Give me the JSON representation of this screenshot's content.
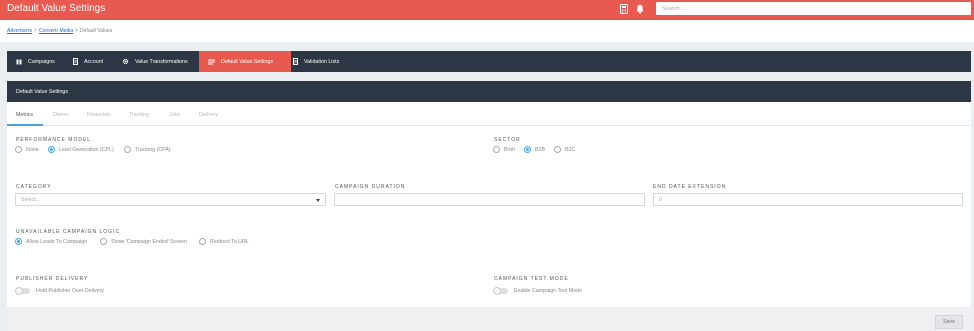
{
  "header": {
    "title": "Default Value Settings",
    "search_placeholder": "Search...",
    "icons": [
      "calculator-icon",
      "bell-icon"
    ]
  },
  "breadcrumb": {
    "items": [
      "Advertisers",
      "Convertr Media",
      "Default Values"
    ],
    "separator": ">"
  },
  "tabs": [
    {
      "label": "Campaigns",
      "icon": "columns-icon",
      "active": false
    },
    {
      "label": "Account",
      "icon": "document-icon",
      "active": false
    },
    {
      "label": "Value Transformations",
      "icon": "gear-icon",
      "active": false
    },
    {
      "label": "Default Value Settings",
      "icon": "list-icon",
      "active": true
    },
    {
      "label": "Validation Lists",
      "icon": "document-icon",
      "active": false
    }
  ],
  "panel": {
    "title": "Default Value Settings",
    "subtabs": [
      "Metrics",
      "Owner",
      "Financials",
      "Tracking",
      "Jobs",
      "Delivery"
    ],
    "active_subtab": "Metrics"
  },
  "performance_model": {
    "label": "Performance Model",
    "options": [
      "None",
      "Lead Generation (CPL)",
      "Tracking (CPA)"
    ],
    "selected": "Lead Generation (CPL)"
  },
  "sector": {
    "label": "Sector",
    "options": [
      "Both",
      "B2B",
      "B2C"
    ],
    "selected": "B2B"
  },
  "category": {
    "label": "Category",
    "placeholder": "Select..."
  },
  "campaign_duration": {
    "label": "Campaign Duration",
    "value": ""
  },
  "end_date_extension": {
    "label": "End Date Extension",
    "value": "0"
  },
  "unavailable_logic": {
    "label": "Unavailable Campaign Logic",
    "options": [
      "Allow Leads To Campaign",
      "Show 'Campaign Ended' Screen",
      "Redirect To URL"
    ],
    "selected": "Allow Leads To Campaign"
  },
  "publisher_delivery": {
    "label": "Publisher Delivery",
    "toggle_label": "Hold Publisher Over Delivery",
    "enabled": false
  },
  "campaign_test_mode": {
    "label": "Campaign Test Mode",
    "toggle_label": "Enable Campaign Test Mode",
    "enabled": false
  },
  "footer": {
    "save_label": "Save"
  },
  "colors": {
    "brand": "#e85a4f",
    "nav_dark": "#2d3644",
    "accent": "#4aa3df"
  }
}
